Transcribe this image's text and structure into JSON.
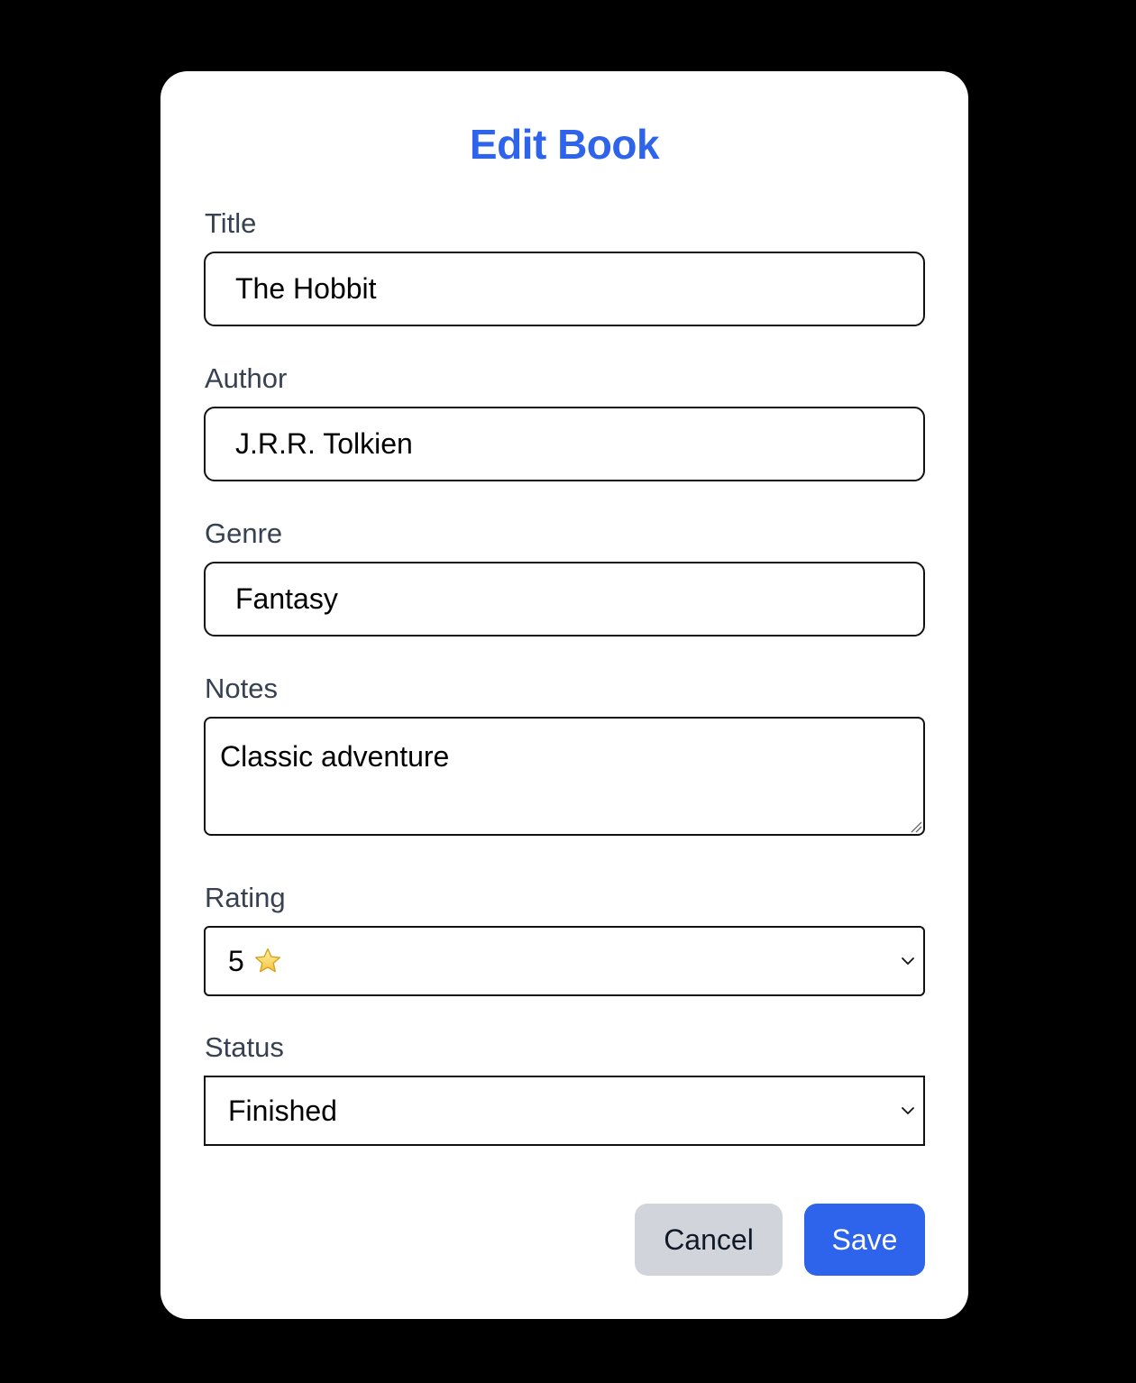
{
  "dialog": {
    "title": "Edit Book",
    "accent_color": "#2e63eb"
  },
  "fields": {
    "title": {
      "label": "Title",
      "value": "The Hobbit"
    },
    "author": {
      "label": "Author",
      "value": "J.R.R. Tolkien"
    },
    "genre": {
      "label": "Genre",
      "value": "Fantasy"
    },
    "notes": {
      "label": "Notes",
      "value": "Classic adventure"
    },
    "rating": {
      "label": "Rating",
      "selected": "5",
      "icon": "star-icon"
    },
    "status": {
      "label": "Status",
      "selected": "Finished"
    }
  },
  "actions": {
    "cancel_label": "Cancel",
    "save_label": "Save"
  }
}
